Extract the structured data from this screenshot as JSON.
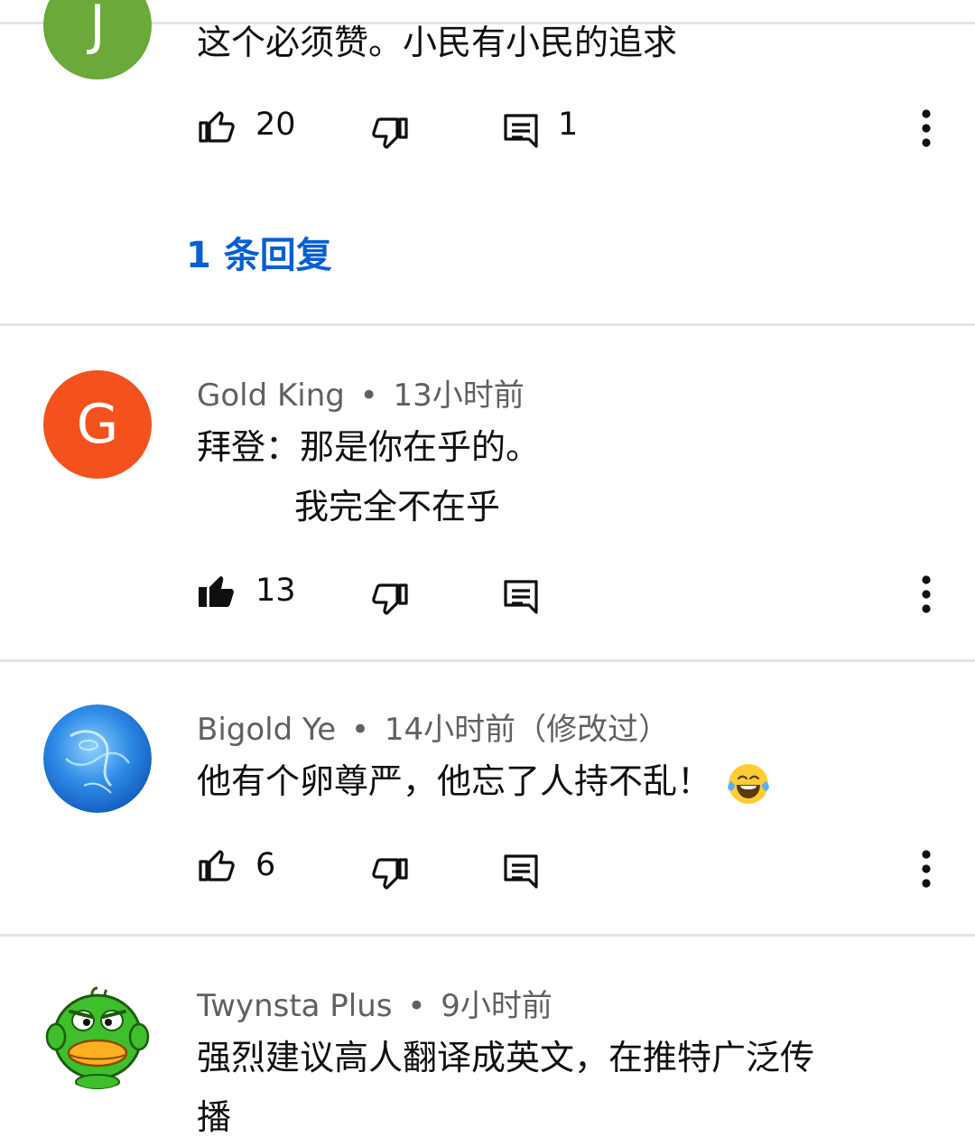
{
  "colors": {
    "accent": "#065fd4",
    "meta_text": "#606060",
    "divider": "#e5e5e5"
  },
  "comments": [
    {
      "avatar_letter": "J",
      "avatar_color": "#6aa93a",
      "text_lines": [
        "这个必须赞。小民有小民的追求"
      ],
      "likes": "20",
      "reply_count": "1",
      "like_state": "not-liked",
      "replies_link": "1 条回复"
    },
    {
      "author": "Gold King",
      "separator": "•",
      "time": "13小时前",
      "avatar_letter": "G",
      "avatar_color": "#f4511e",
      "text_lines": [
        "拜登：那是你在乎的。",
        "我完全不在乎"
      ],
      "likes": "13",
      "like_state": "liked"
    },
    {
      "author": "Bigold Ye",
      "separator": "•",
      "time": "14小时前（修改过）",
      "avatar_icon": "blue-koi-avatar",
      "text_lines": [
        "他有个卵尊严，他忘了人持不乱！"
      ],
      "emoji": "laughing-tears-emoji",
      "likes": "6",
      "like_state": "not-liked"
    },
    {
      "author": "Twynsta Plus",
      "separator": "•",
      "time": "9小时前",
      "avatar_icon": "green-duck-avatar",
      "text_lines": [
        "强烈建议高人翻译成英文，在推特广泛传",
        "播"
      ]
    }
  ]
}
